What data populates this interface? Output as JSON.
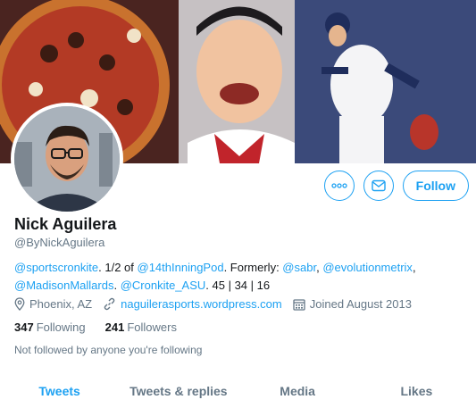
{
  "profile": {
    "name": "Nick Aguilera",
    "handle": "@ByNickAguilera"
  },
  "actions": {
    "more_icon": "more-dots-icon",
    "message_icon": "envelope-icon",
    "follow_label": "Follow"
  },
  "bio": {
    "mention_1": "@sportscronkite",
    "text_1": ". 1/2 of ",
    "mention_2": "@14thInningPod",
    "text_2": ". Formerly: ",
    "mention_3": "@sabr",
    "text_3": ", ",
    "mention_4": "@evolutionmetrix",
    "text_4": ",",
    "mention_5": "@MadisonMallards",
    "text_5": ". ",
    "mention_6": "@Cronkite_ASU",
    "text_6": ". 45 | 34 | 16"
  },
  "meta": {
    "location": "Phoenix, AZ",
    "website": "naguilerasports.wordpress.com",
    "joined": "Joined August 2013"
  },
  "counts": {
    "following_count": "347",
    "following_label": "Following",
    "followers_count": "241",
    "followers_label": "Followers"
  },
  "not_followed_text": "Not followed by anyone you're following",
  "tabs": [
    {
      "label": "Tweets",
      "active": true
    },
    {
      "label": "Tweets & replies",
      "active": false
    },
    {
      "label": "Media",
      "active": false
    },
    {
      "label": "Likes",
      "active": false
    }
  ],
  "colors": {
    "accent": "#1da1f2",
    "muted": "#657786",
    "text": "#14171a"
  }
}
